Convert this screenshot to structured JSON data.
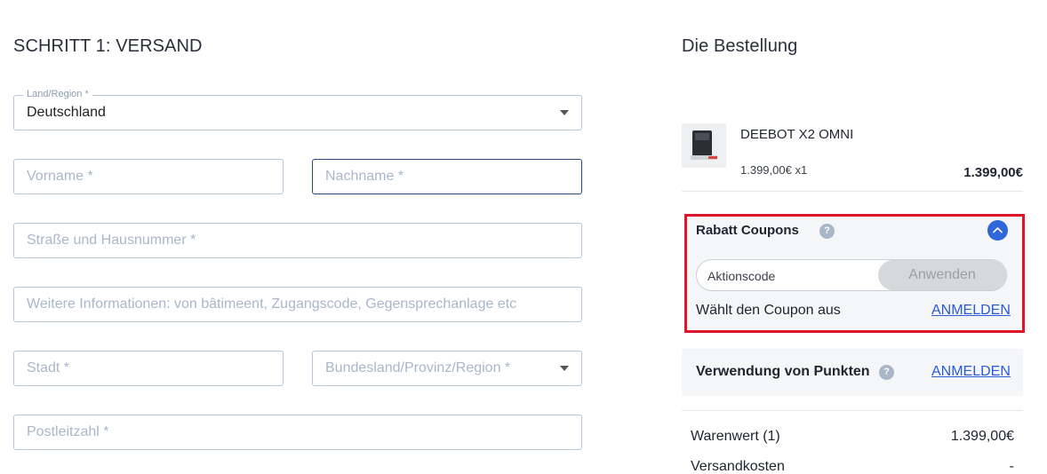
{
  "shipping": {
    "heading": "SCHRITT 1: VERSAND",
    "country": {
      "label": "Land/Region *",
      "value": "Deutschland"
    },
    "first_name": {
      "placeholder": "Vorname *"
    },
    "last_name": {
      "placeholder": "Nachname *"
    },
    "street": {
      "placeholder": "Straße und Hausnummer *"
    },
    "additional": {
      "placeholder": "Weitere Informationen: von bâtimeent, Zugangscode, Gegensprechanlage etc"
    },
    "city": {
      "placeholder": "Stadt *"
    },
    "state": {
      "placeholder": "Bundesland/Provinz/Region *"
    },
    "zip": {
      "placeholder": "Postleitzahl *"
    }
  },
  "order": {
    "heading": "Die Bestellung",
    "item": {
      "name": "DEEBOT X2 OMNI",
      "unit_qty": "1.399,00€ x1",
      "total": "1.399,00€"
    },
    "coupons": {
      "title": "Rabatt Coupons",
      "help": "?",
      "code_placeholder": "Aktionscode",
      "apply": "Anwenden",
      "select_text": "Wählt den Coupon aus",
      "login": "ANMELDEN"
    },
    "points": {
      "title": "Verwendung von Punkten",
      "help": "?",
      "login": "ANMELDEN"
    },
    "summary": [
      {
        "label": "Warenwert (1)",
        "value": "1.399,00€"
      },
      {
        "label": "Versandkosten",
        "value": "-"
      }
    ]
  },
  "colors": {
    "accent": "#2f66d9",
    "highlight": "#e0142a",
    "field_border": "#b9c6d8",
    "placeholder": "#a9b7cb"
  }
}
